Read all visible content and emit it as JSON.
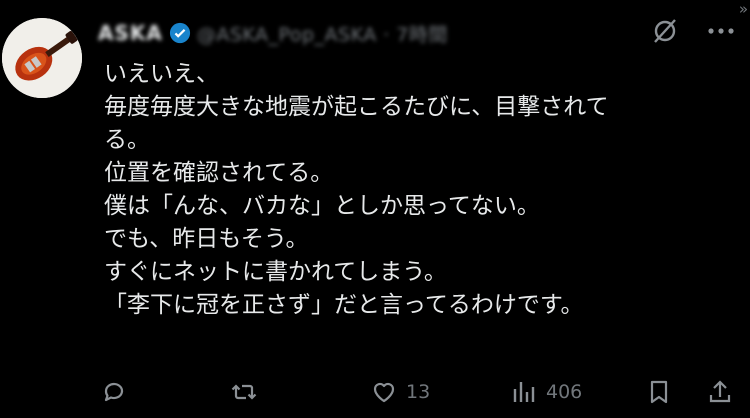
{
  "tweet": {
    "author_name": "ASKA",
    "author_handle": "@ASKA_Pop_ASKA · 7時間",
    "lines": [
      "いえいえ、",
      "毎度毎度大きな地震が起こるたびに、目撃されて",
      "る。",
      "位置を確認されてる。",
      "僕は「んな、バカな」としか思ってない。",
      "でも、昨日もそう。",
      "すぐにネットに書かれてしまう。",
      "「李下に冠を正さず」だと言ってるわけです。"
    ]
  },
  "actions": {
    "likes": "13",
    "views": "406"
  },
  "icons": {
    "corner": "»",
    "reply": "reply-icon",
    "retweet": "retweet-icon",
    "like": "heart-icon",
    "views": "views-icon",
    "bookmark": "bookmark-icon",
    "share": "share-icon"
  },
  "colors": {
    "background": "#000000",
    "text": "#e7e9ea",
    "muted": "#71767b",
    "verified": "#1d9bf0"
  }
}
